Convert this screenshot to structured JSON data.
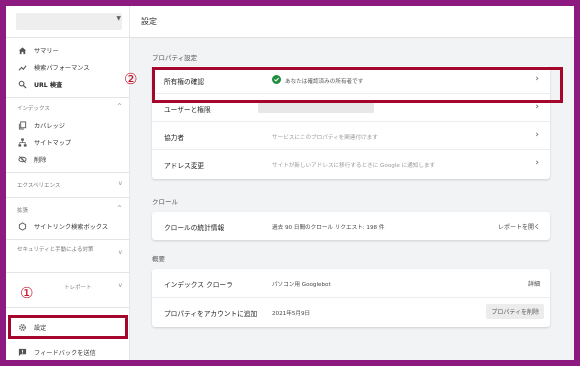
{
  "sidebar": {
    "overview_label": "サマリー",
    "performance_label": "検索パフォーマンス",
    "url_inspection_label": "URL 検査",
    "index_section": "インデックス",
    "coverage_label": "カバレッジ",
    "sitemaps_label": "サイトマップ",
    "removals_label": "削除",
    "experience_section": "エクスペリエンス",
    "enhancements_section": "拡張",
    "sitelinks_label": "サイトリンク検索ボックス",
    "security_section": "セキュリティと手動による対策",
    "legacy_section": "トレポート",
    "settings_label": "設定",
    "feedback_label": "フィードバックを送信"
  },
  "header": {
    "title": "設定"
  },
  "property_settings": {
    "section_title": "プロパティ設定",
    "rows": [
      {
        "label": "所有権の確認",
        "value": "あなたは確認済みの所有者です"
      },
      {
        "label": "ユーザーと権限",
        "value": ""
      },
      {
        "label": "協力者",
        "value": "サービスにこのプロパティを関連付けます"
      },
      {
        "label": "アドレス変更",
        "value": "サイトが新しいアドレスに移行するときに Google に通知します"
      }
    ]
  },
  "crawl": {
    "section_title": "クロール",
    "label": "クロールの統計情報",
    "value": "過去 90 日間のクロール リクエスト: 198 件",
    "action": "レポートを開く"
  },
  "about": {
    "section_title": "概要",
    "rows": [
      {
        "label": "インデックス クローラ",
        "value": "パソコン用 Googlebot",
        "action": "詳細"
      },
      {
        "label": "プロパティをアカウントに追加",
        "value": "2021年5月9日",
        "action": "プロパティを削除"
      }
    ]
  },
  "annotations": {
    "badge1": "①",
    "badge2": "②"
  },
  "colors": {
    "highlight": "#a5062c",
    "frame": "#8c1a80",
    "verified": "#1e8e3e"
  }
}
